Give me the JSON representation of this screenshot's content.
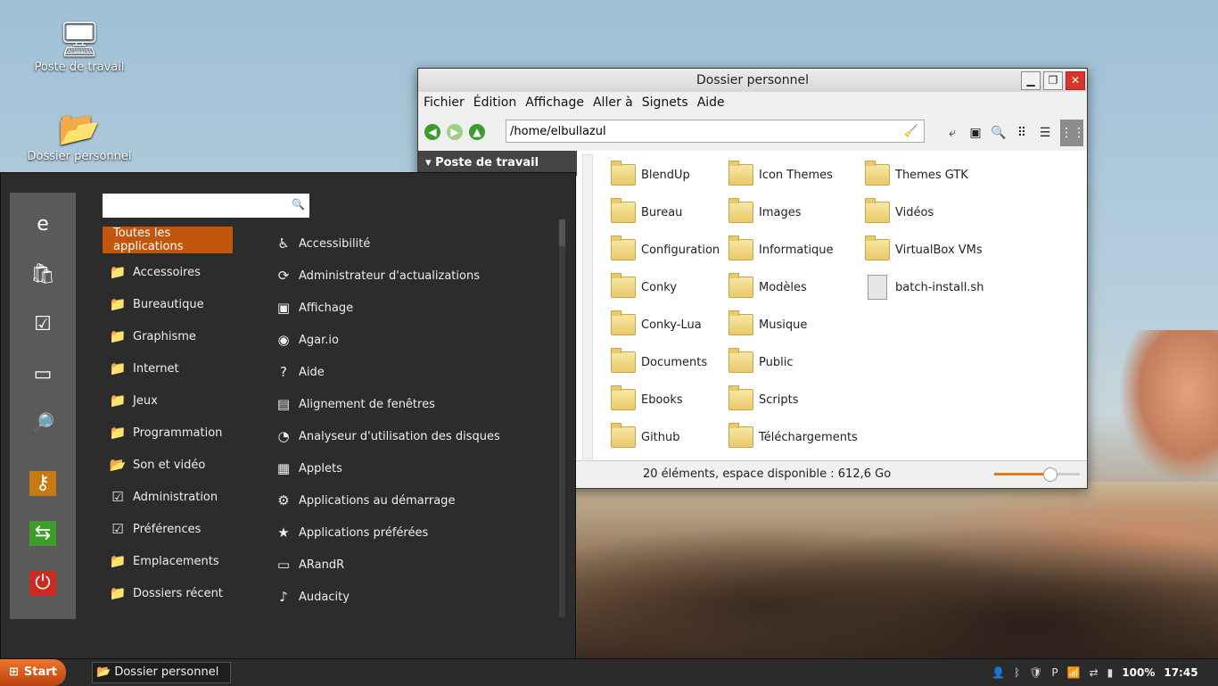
{
  "desktop": {
    "icons": [
      {
        "label": "Poste de travail",
        "icon": "computer-icon"
      },
      {
        "label": "Dossier personnel",
        "icon": "home-folder-icon"
      }
    ]
  },
  "window": {
    "title": "Dossier personnel",
    "controls": {
      "minimize": "▁",
      "maximize": "❐",
      "close": "✕"
    },
    "menu": [
      "Fichier",
      "Édition",
      "Affichage",
      "Aller à",
      "Signets",
      "Aide"
    ],
    "location": "/home/elbullazul",
    "sidebar_header": "Poste de travail",
    "files": [
      {
        "name": "BlendUp",
        "col": 0,
        "row": 0,
        "type": "folder"
      },
      {
        "name": "Bureau",
        "col": 0,
        "row": 1,
        "type": "folder"
      },
      {
        "name": "Configuration",
        "col": 0,
        "row": 2,
        "type": "folder"
      },
      {
        "name": "Conky",
        "col": 0,
        "row": 3,
        "type": "folder"
      },
      {
        "name": "Conky-Lua",
        "col": 0,
        "row": 4,
        "type": "folder"
      },
      {
        "name": "Documents",
        "col": 0,
        "row": 5,
        "type": "folder"
      },
      {
        "name": "Ebooks",
        "col": 0,
        "row": 6,
        "type": "folder"
      },
      {
        "name": "Github",
        "col": 0,
        "row": 7,
        "type": "folder"
      },
      {
        "name": "Icon Themes",
        "col": 1,
        "row": 0,
        "type": "folder"
      },
      {
        "name": "Images",
        "col": 1,
        "row": 1,
        "type": "folder"
      },
      {
        "name": "Informatique",
        "col": 1,
        "row": 2,
        "type": "folder"
      },
      {
        "name": "Modèles",
        "col": 1,
        "row": 3,
        "type": "folder"
      },
      {
        "name": "Musique",
        "col": 1,
        "row": 4,
        "type": "folder"
      },
      {
        "name": "Public",
        "col": 1,
        "row": 5,
        "type": "folder"
      },
      {
        "name": "Scripts",
        "col": 1,
        "row": 6,
        "type": "folder"
      },
      {
        "name": "Téléchargements",
        "col": 1,
        "row": 7,
        "type": "folder"
      },
      {
        "name": "Themes GTK",
        "col": 2,
        "row": 0,
        "type": "folder"
      },
      {
        "name": "Vidéos",
        "col": 2,
        "row": 1,
        "type": "folder"
      },
      {
        "name": "VirtualBox VMs",
        "col": 2,
        "row": 2,
        "type": "folder"
      },
      {
        "name": "batch-install.sh",
        "col": 2,
        "row": 3,
        "type": "file"
      }
    ],
    "status": "20 éléments, espace disponible : 612,6 Go",
    "zoom_level": 0.65
  },
  "startmenu": {
    "search_placeholder": "",
    "categories": [
      "Toutes les applications",
      "Accessoires",
      "Bureautique",
      "Graphisme",
      "Internet",
      "Jeux",
      "Programmation",
      "Son et vidéo",
      "Administration",
      "Préférences",
      "Emplacements",
      "Dossiers récent"
    ],
    "apps": [
      "Accessibilité",
      "Administrateur d'actualizations",
      "Affichage",
      "Agar.io",
      "Aide",
      "Alignement de fenêtres",
      "Analyseur d'utilisation des disques",
      "Applets",
      "Applications au démarrage",
      "Applications préférées",
      "ARandR",
      "Audacity"
    ]
  },
  "taskbar": {
    "start_label": "Start",
    "task_label": "Dossier personnel",
    "battery": "100%",
    "clock": "17:45"
  },
  "colors": {
    "accent": "#c2560c",
    "menu_bg": "#2c2c2c",
    "taskbar_bg": "#2b2b2b"
  }
}
